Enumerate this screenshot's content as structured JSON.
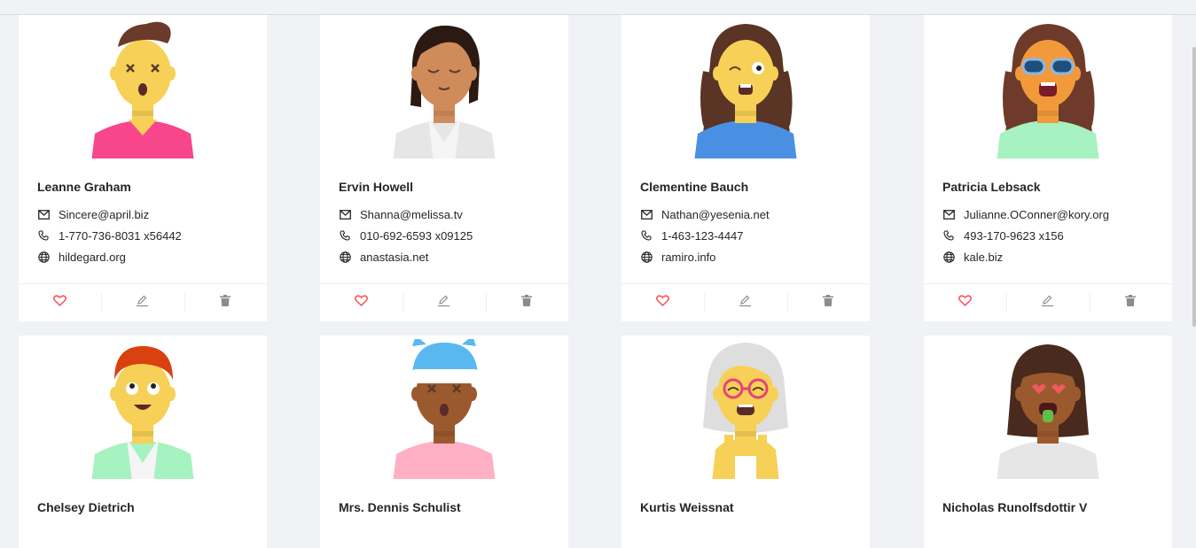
{
  "users": [
    {
      "name": "Leanne Graham",
      "email": "Sincere@april.biz",
      "phone": "1-770-736-8031 x56442",
      "website": "hildegard.org",
      "avatar": {
        "skin": "#f7d057",
        "hair": "#6b3a2a",
        "shirt": "#f7468b",
        "style": "quiff",
        "face": "dizzy"
      }
    },
    {
      "name": "Ervin Howell",
      "email": "Shanna@melissa.tv",
      "phone": "010-692-6593 x09125",
      "website": "anastasia.net",
      "avatar": {
        "skin": "#d08b5b",
        "hair": "#2c1a12",
        "shirt": "#e6e6e6",
        "style": "bob",
        "face": "calm"
      }
    },
    {
      "name": "Clementine Bauch",
      "email": "Nathan@yesenia.net",
      "phone": "1-463-123-4447",
      "website": "ramiro.info",
      "avatar": {
        "skin": "#f7d057",
        "hair": "#5a3424",
        "shirt": "#4a90e2",
        "style": "dreads",
        "face": "wink"
      }
    },
    {
      "name": "Patricia Lebsack",
      "email": "Julianne.OConner@kory.org",
      "phone": "493-170-9623 x156",
      "website": "kale.biz",
      "avatar": {
        "skin": "#f29a3b",
        "hair": "#6e3b2b",
        "shirt": "#a6f2c0",
        "style": "dreads",
        "face": "shades"
      }
    },
    {
      "name": "Chelsey Dietrich",
      "avatar": {
        "skin": "#f7d057",
        "hair": "#d9410f",
        "shirt": "#a6f2c0",
        "style": "short",
        "face": "rolleyes"
      }
    },
    {
      "name": "Mrs. Dennis Schulist",
      "avatar": {
        "skin": "#9b5a2e",
        "hair": "#5ab8f0",
        "shirt": "#ffb0c4",
        "style": "beanie",
        "face": "dizzy"
      }
    },
    {
      "name": "Kurtis Weissnat",
      "avatar": {
        "skin": "#f7d057",
        "hair": "#dedede",
        "shirt": "#f7d057",
        "style": "longgray",
        "face": "glasses"
      }
    },
    {
      "name": "Nicholas Runolfsdottir V",
      "avatar": {
        "skin": "#9b5a2e",
        "hair": "#4a2a1c",
        "shirt": "#e6e6e6",
        "style": "bob2",
        "face": "hearts"
      }
    }
  ],
  "colors": {
    "heart": "#ff4d4f",
    "icon": "#8c8c8c"
  },
  "icons": {
    "email": "mail-icon",
    "phone": "phone-icon",
    "website": "globe-icon",
    "like": "heart-icon",
    "edit": "edit-icon",
    "delete": "delete-icon"
  }
}
